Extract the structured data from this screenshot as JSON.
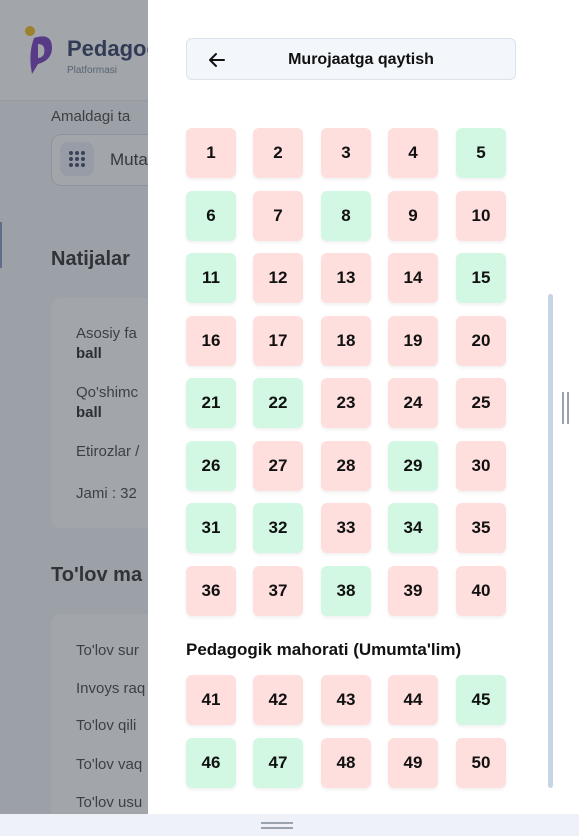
{
  "background": {
    "logo_title": "Pedagog",
    "logo_sub": "Platformasi",
    "current_label": "Amaldagi ta",
    "select_text": "Muta",
    "results_heading": "Natijalar",
    "results_rows": [
      {
        "line1": "Asosiy fa",
        "line2": "ball"
      },
      {
        "line1": "Qo'shimc",
        "line2": "ball"
      },
      {
        "line1": "Etirozlar /",
        "line2": ""
      },
      {
        "line1": "Jami : 32",
        "line2": ""
      }
    ],
    "payment_heading": "To'lov ma",
    "payment_rows": [
      "To'lov sur",
      "Invoys raq",
      "To'lov qili",
      "To'lov vaq",
      "To'lov usu"
    ]
  },
  "panel": {
    "back_button_label": "Murojaatga qaytish",
    "section2_title": "Pedagogik mahorati (Umumta'lim)",
    "colors": {
      "wrong": "#ffdede",
      "right": "#d2f8e3"
    },
    "questions_section1": [
      {
        "n": "1",
        "status": "wrong"
      },
      {
        "n": "2",
        "status": "wrong"
      },
      {
        "n": "3",
        "status": "wrong"
      },
      {
        "n": "4",
        "status": "wrong"
      },
      {
        "n": "5",
        "status": "right"
      },
      {
        "n": "6",
        "status": "right"
      },
      {
        "n": "7",
        "status": "wrong"
      },
      {
        "n": "8",
        "status": "right"
      },
      {
        "n": "9",
        "status": "wrong"
      },
      {
        "n": "10",
        "status": "wrong"
      },
      {
        "n": "11",
        "status": "right"
      },
      {
        "n": "12",
        "status": "wrong"
      },
      {
        "n": "13",
        "status": "wrong"
      },
      {
        "n": "14",
        "status": "wrong"
      },
      {
        "n": "15",
        "status": "right"
      },
      {
        "n": "16",
        "status": "wrong"
      },
      {
        "n": "17",
        "status": "wrong"
      },
      {
        "n": "18",
        "status": "wrong"
      },
      {
        "n": "19",
        "status": "wrong"
      },
      {
        "n": "20",
        "status": "wrong"
      },
      {
        "n": "21",
        "status": "right"
      },
      {
        "n": "22",
        "status": "right"
      },
      {
        "n": "23",
        "status": "wrong"
      },
      {
        "n": "24",
        "status": "wrong"
      },
      {
        "n": "25",
        "status": "wrong"
      },
      {
        "n": "26",
        "status": "right"
      },
      {
        "n": "27",
        "status": "wrong"
      },
      {
        "n": "28",
        "status": "wrong"
      },
      {
        "n": "29",
        "status": "right"
      },
      {
        "n": "30",
        "status": "wrong"
      },
      {
        "n": "31",
        "status": "right"
      },
      {
        "n": "32",
        "status": "right"
      },
      {
        "n": "33",
        "status": "wrong"
      },
      {
        "n": "34",
        "status": "right"
      },
      {
        "n": "35",
        "status": "wrong"
      },
      {
        "n": "36",
        "status": "wrong"
      },
      {
        "n": "37",
        "status": "wrong"
      },
      {
        "n": "38",
        "status": "right"
      },
      {
        "n": "39",
        "status": "wrong"
      },
      {
        "n": "40",
        "status": "wrong"
      }
    ],
    "questions_section2": [
      {
        "n": "41",
        "status": "wrong"
      },
      {
        "n": "42",
        "status": "wrong"
      },
      {
        "n": "43",
        "status": "wrong"
      },
      {
        "n": "44",
        "status": "wrong"
      },
      {
        "n": "45",
        "status": "right"
      },
      {
        "n": "46",
        "status": "right"
      },
      {
        "n": "47",
        "status": "right"
      },
      {
        "n": "48",
        "status": "wrong"
      },
      {
        "n": "49",
        "status": "wrong"
      },
      {
        "n": "50",
        "status": "wrong"
      }
    ]
  }
}
